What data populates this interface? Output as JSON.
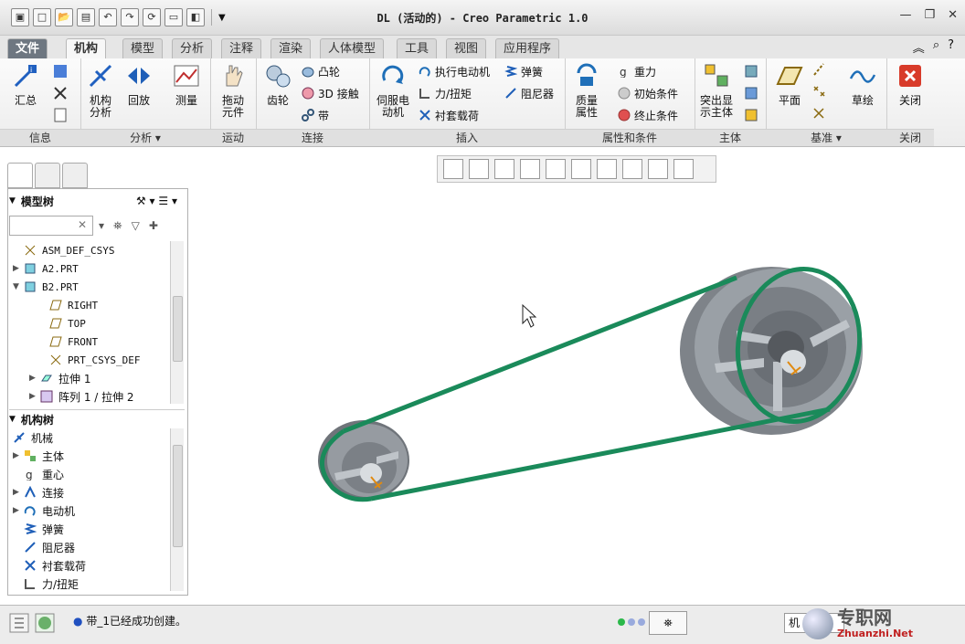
{
  "title": "DL (活动的) - Creo Parametric 1.0",
  "tabs": [
    "文件",
    "机构",
    "模型",
    "分析",
    "注释",
    "渲染",
    "人体模型",
    "工具",
    "视图",
    "应用程序"
  ],
  "ribbon": {
    "info": {
      "name": "信息",
      "summary": "汇总"
    },
    "analysis": {
      "name": "分析",
      "mech_analysis": "机构\n分析",
      "playback": "回放",
      "measure": "测量"
    },
    "motion": {
      "name": "运动",
      "drag": "拖动\n元件"
    },
    "connect": {
      "name": "连接",
      "gear": "齿轮",
      "cam": "凸轮",
      "contact3d": "3D 接触",
      "belt": "带"
    },
    "insert": {
      "name": "插入",
      "servo": "伺服电\n动机",
      "exec_motor": "执行电动机",
      "force": "力/扭矩",
      "bushing": "衬套载荷",
      "spring": "弹簧",
      "damper": "阻尼器"
    },
    "props": {
      "name": "属性和条件",
      "mass": "质量\n属性",
      "gravity": "重力",
      "initial": "初始条件",
      "termination": "终止条件"
    },
    "body": {
      "name": "主体",
      "highlight": "突出显\n示主体"
    },
    "datum": {
      "name": "基准",
      "plane": "平面",
      "sketch": "草绘"
    },
    "close": {
      "name": "关闭",
      "label": "关闭"
    }
  },
  "model_tree": {
    "header": "模型树",
    "items": [
      "ASM_DEF_CSYS",
      "A2.PRT",
      "B2.PRT",
      "RIGHT",
      "TOP",
      "FRONT",
      "PRT_CSYS_DEF",
      "拉伸 1",
      "阵列 1 / 拉伸 2"
    ]
  },
  "mech_tree": {
    "header": "机构树",
    "items": [
      "机械",
      "主体",
      "重心",
      "连接",
      "电动机",
      "弹簧",
      "阻尼器",
      "衬套载荷",
      "力/扭矩"
    ]
  },
  "status_message": "带_1已经成功创建。",
  "status_right": "机",
  "watermark": {
    "cn": "专职网",
    "en": "Zhuanzhi.Net"
  },
  "colors": {
    "belt": "#1a8a5a",
    "pulley": "#8a8f96",
    "ribbon_bg": "#f2f2f2"
  }
}
